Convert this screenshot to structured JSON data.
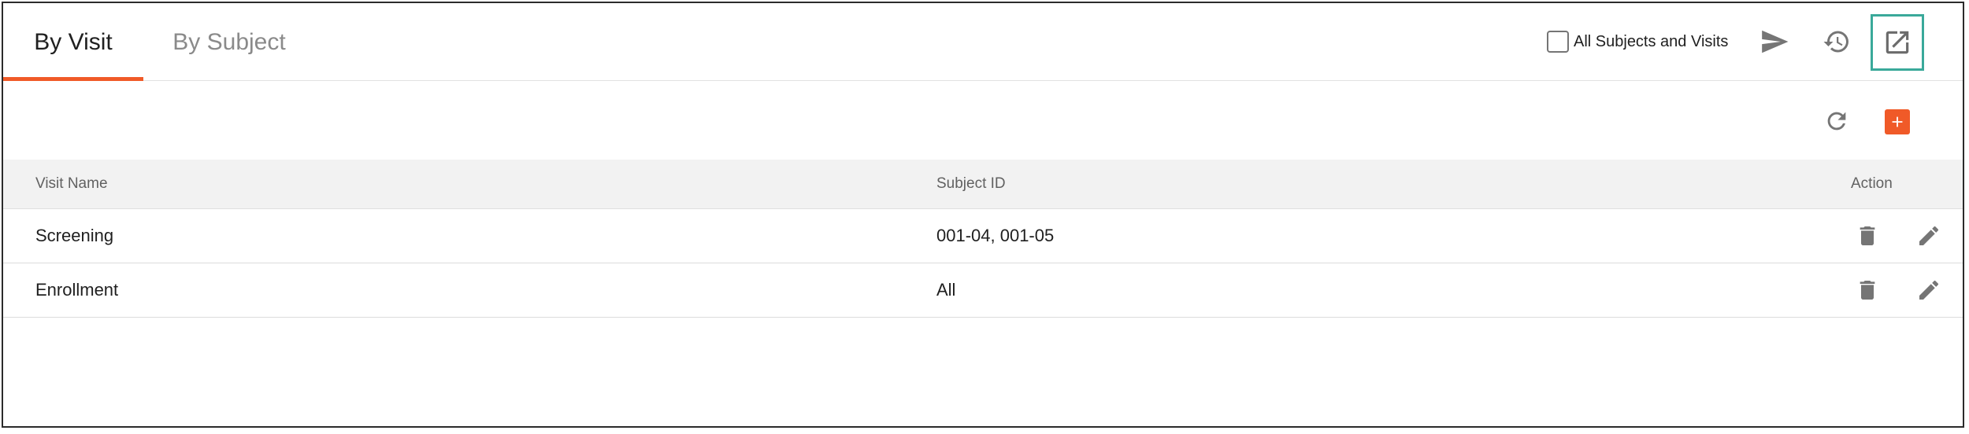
{
  "tabs": [
    {
      "label": "By Visit",
      "active": true
    },
    {
      "label": "By Subject",
      "active": false
    }
  ],
  "header": {
    "all_subjects_label": "All Subjects and Visits",
    "all_subjects_checked": false,
    "icons": [
      "send-icon",
      "history-icon",
      "open-in-new-icon"
    ]
  },
  "toolbar": {
    "icons": [
      "refresh-icon",
      "add-icon"
    ]
  },
  "table": {
    "columns": [
      "Visit Name",
      "Subject ID",
      "Action"
    ],
    "rows": [
      {
        "visit_name": "Screening",
        "subject_id": "001-04, 001-05"
      },
      {
        "visit_name": "Enrollment",
        "subject_id": "All"
      }
    ],
    "row_actions": [
      "delete-icon",
      "edit-icon"
    ]
  },
  "colors": {
    "accent": "#f05a28",
    "highlight_border": "#3aa99a",
    "header_bg": "#f2f2f2",
    "icon_gray": "#757575"
  }
}
